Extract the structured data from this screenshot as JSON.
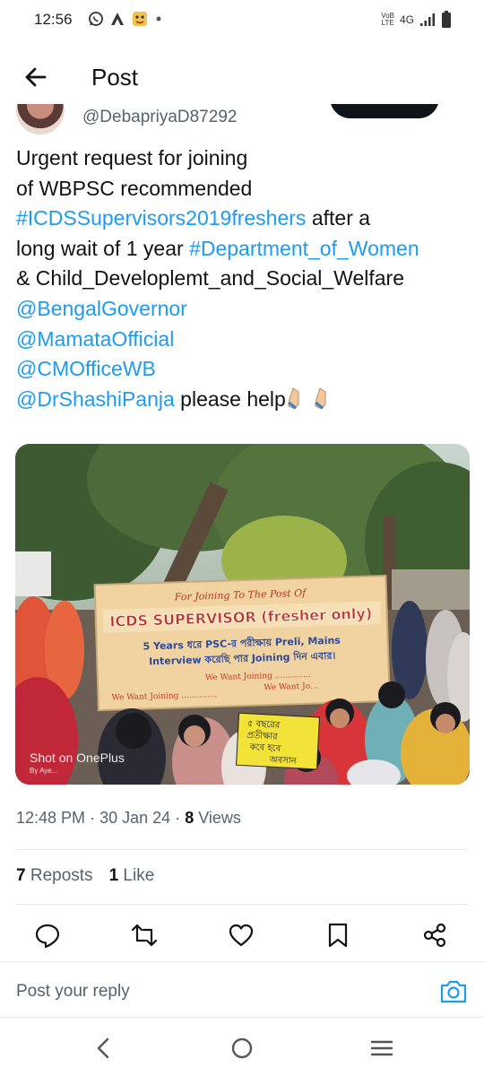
{
  "status_bar": {
    "time": "12:56",
    "left_icons": [
      "whatsapp-icon",
      "a-icon",
      "emoji-face-icon",
      "dot-icon"
    ],
    "volte_top": "VoB",
    "volte_bottom": "LTE",
    "network": "4G",
    "right_icons": [
      "signal-icon",
      "battery-icon"
    ]
  },
  "header": {
    "title": "Post"
  },
  "post": {
    "handle": "@DebapriyaD87292",
    "text": {
      "line1": "Urgent request for joining",
      "line2": "of WBPSC recommended",
      "hashtag1": "#ICDSSupervisors2019freshers",
      "after_hashtag1": " after a",
      "line4_pre": "long wait of 1 year ",
      "hashtag2": "#Department_of_Women",
      "line5": "& Child_Developlemt_and_Social_Welfare",
      "mention1": "@BengalGovernor",
      "mention2": "@MamataOfficial",
      "mention3": "@CMOfficeWB",
      "mention4": "@DrShashiPanja",
      "after_mention4": " please help",
      "emoji": "folded-hands-emoji x2"
    },
    "image": {
      "banner_line1": "For Joining To The Post Of",
      "banner_line2": "ICDS SUPERVISOR (fresher only)",
      "banner_line3": "5 Years ধরে PSC-র পরীক্ষায় Preli, Mains",
      "banner_line4": "Interview করেছি পার Joining দিন এবার।",
      "banner_line5": "We Want Joining ..............",
      "banner_line6": "We Want Joining ..............",
      "banner_line7": "We Want Jo...",
      "placard_line1": "৫ বছরের",
      "placard_line2": "প্রতীক্ষার",
      "placard_line3": "কবে হবে",
      "placard_line4": "অবসান",
      "watermark1": "Shot on OnePlus",
      "watermark2": "By Aye..."
    },
    "time": "12:48 PM",
    "separator": "·",
    "date": "30 Jan 24",
    "views_count": "8",
    "views_label": " Views"
  },
  "stats": {
    "reposts_count": "7",
    "reposts_label": "Reposts",
    "likes_count": "1",
    "likes_label": "Like"
  },
  "actions": [
    "reply-icon",
    "repost-icon",
    "like-icon",
    "bookmark-icon",
    "share-icon"
  ],
  "reply": {
    "placeholder": "Post your reply"
  },
  "colors": {
    "link": "#1d9bf0",
    "text": "#0f1419",
    "secondary": "#536471"
  }
}
